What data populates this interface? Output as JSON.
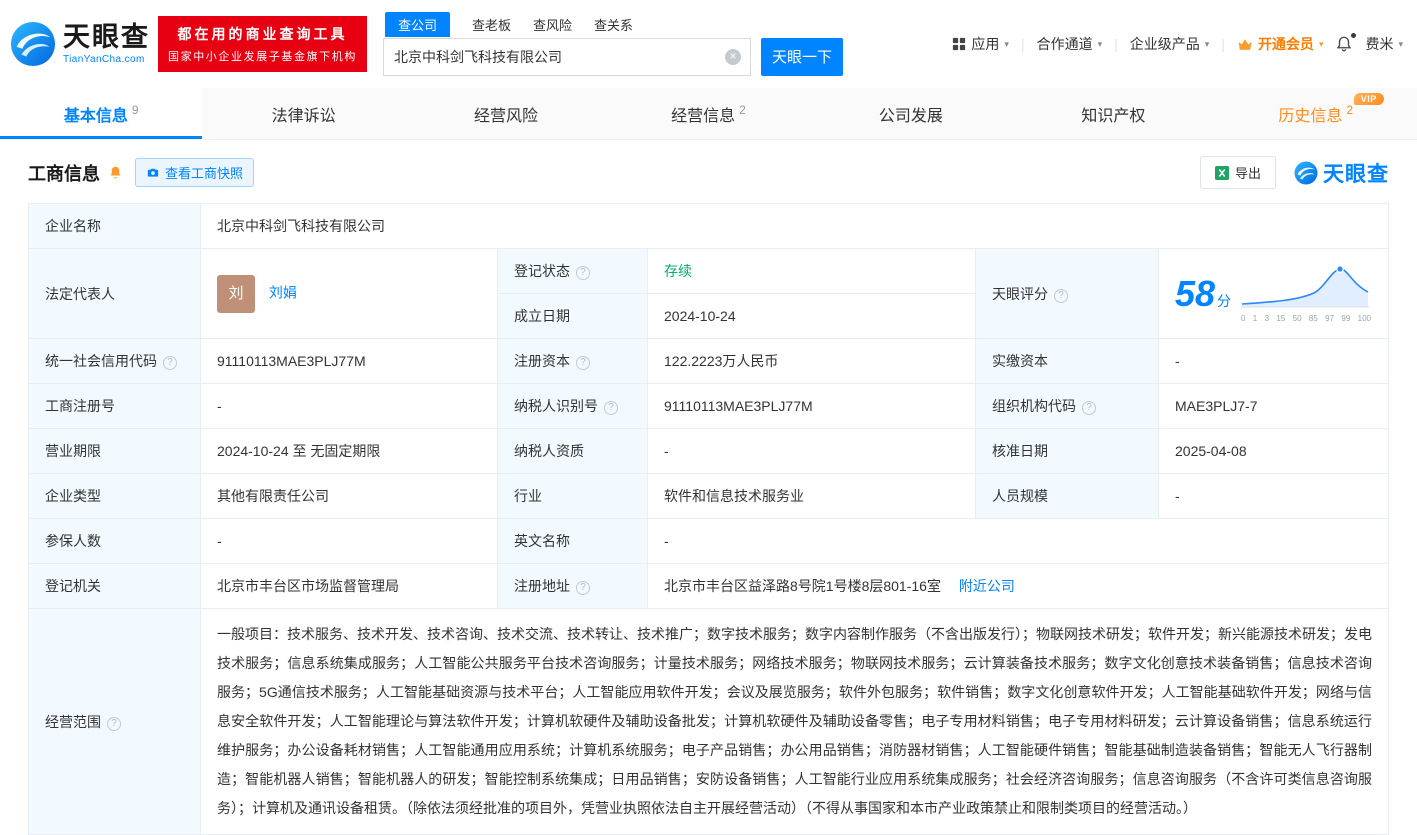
{
  "brand": {
    "name": "天眼查",
    "domain": "TianYanCha.com",
    "accent": "#0084ff"
  },
  "promo": {
    "line1": "都在用的商业查询工具",
    "line2": "国家中小企业发展子基金旗下机构"
  },
  "search": {
    "tabs": [
      {
        "label": "查公司",
        "active": true
      },
      {
        "label": "查老板",
        "active": false
      },
      {
        "label": "查风险",
        "active": false
      },
      {
        "label": "查关系",
        "active": false
      }
    ],
    "value": "北京中科剑飞科技有限公司",
    "button": "天眼一下"
  },
  "top_menu": {
    "apps": "应用",
    "partner": "合作通道",
    "enterprise": "企业级产品",
    "vip": "开通会员",
    "user": "费米"
  },
  "nav_tabs": [
    {
      "label": "基本信息",
      "count": "9",
      "active": true
    },
    {
      "label": "法律诉讼",
      "count": ""
    },
    {
      "label": "经营风险",
      "count": ""
    },
    {
      "label": "经营信息",
      "count": "2"
    },
    {
      "label": "公司发展",
      "count": ""
    },
    {
      "label": "知识产权",
      "count": ""
    },
    {
      "label": "历史信息",
      "count": "2",
      "vip_badge": "VIP"
    }
  ],
  "section": {
    "title": "工商信息",
    "snapshot_button": "查看工商快照",
    "export_button": "导出",
    "logo": "天眼查"
  },
  "score": {
    "value": "58",
    "unit": "分",
    "axis": [
      "0",
      "1",
      "3",
      "15",
      "50",
      "85",
      "97",
      "99",
      "100"
    ]
  },
  "fields": {
    "company_name": {
      "label": "企业名称",
      "value": "北京中科剑飞科技有限公司"
    },
    "legal_rep": {
      "label": "法定代表人",
      "avatar": "刘",
      "value": "刘娟"
    },
    "reg_status": {
      "label": "登记状态",
      "value": "存续"
    },
    "establish_date": {
      "label": "成立日期",
      "value": "2024-10-24"
    },
    "score": {
      "label": "天眼评分"
    },
    "credit_code": {
      "label": "统一社会信用代码",
      "value": "91110113MAE3PLJ77M"
    },
    "reg_capital": {
      "label": "注册资本",
      "value": "122.2223万人民币"
    },
    "paid_capital": {
      "label": "实缴资本",
      "value": "-"
    },
    "reg_number": {
      "label": "工商注册号",
      "value": "-"
    },
    "taxpayer_id": {
      "label": "纳税人识别号",
      "value": "91110113MAE3PLJ77M"
    },
    "org_code": {
      "label": "组织机构代码",
      "value": "MAE3PLJ7-7"
    },
    "business_term": {
      "label": "营业期限",
      "value": "2024-10-24 至 无固定期限"
    },
    "taxpayer_quals": {
      "label": "纳税人资质",
      "value": "-"
    },
    "approval_date": {
      "label": "核准日期",
      "value": "2025-04-08"
    },
    "company_type": {
      "label": "企业类型",
      "value": "其他有限责任公司"
    },
    "industry": {
      "label": "行业",
      "value": "软件和信息技术服务业"
    },
    "staff_size": {
      "label": "人员规模",
      "value": "-"
    },
    "insured_count": {
      "label": "参保人数",
      "value": "-"
    },
    "english_name": {
      "label": "英文名称",
      "value": "-"
    },
    "reg_authority": {
      "label": "登记机关",
      "value": "北京市丰台区市场监督管理局"
    },
    "reg_address": {
      "label": "注册地址",
      "value": "北京市丰台区益泽路8号院1号楼8层801-16室",
      "link": "附近公司"
    },
    "business_scope": {
      "label": "经营范围",
      "value": "一般项目：技术服务、技术开发、技术咨询、技术交流、技术转让、技术推广；数字技术服务；数字内容制作服务（不含出版发行）；物联网技术研发；软件开发；新兴能源技术研发；发电技术服务；信息系统集成服务；人工智能公共服务平台技术咨询服务；计量技术服务；网络技术服务；物联网技术服务；云计算装备技术服务；数字文化创意技术装备销售；信息技术咨询服务；5G通信技术服务；人工智能基础资源与技术平台；人工智能应用软件开发；会议及展览服务；软件外包服务；软件销售；数字文化创意软件开发；人工智能基础软件开发；网络与信息安全软件开发；人工智能理论与算法软件开发；计算机软硬件及辅助设备批发；计算机软硬件及辅助设备零售；电子专用材料销售；电子专用材料研发；云计算设备销售；信息系统运行维护服务；办公设备耗材销售；人工智能通用应用系统；计算机系统服务；电子产品销售；办公用品销售；消防器材销售；人工智能硬件销售；智能基础制造装备销售；智能无人飞行器制造；智能机器人销售；智能机器人的研发；智能控制系统集成；日用品销售；安防设备销售；人工智能行业应用系统集成服务；社会经济咨询服务；信息咨询服务（不含许可类信息咨询服务）；计算机及通讯设备租赁。（除依法须经批准的项目外，凭营业执照依法自主开展经营活动）（不得从事国家和本市产业政策禁止和限制类项目的经营活动。）"
    }
  }
}
